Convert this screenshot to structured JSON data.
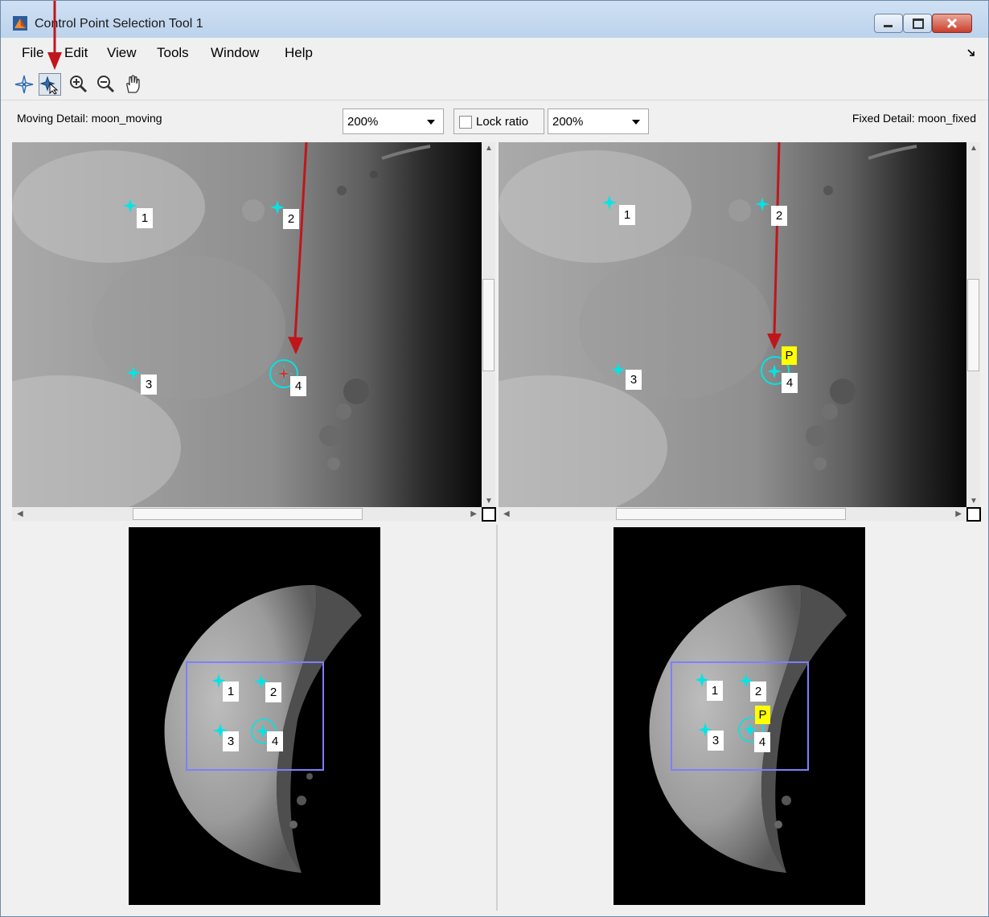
{
  "window": {
    "title": "Control Point Selection Tool 1",
    "buttons": [
      "minimize",
      "maximize",
      "close"
    ]
  },
  "menu": [
    "File",
    "Edit",
    "View",
    "Tools",
    "Window",
    "Help"
  ],
  "toolbar": {
    "icons": [
      "add-point-icon",
      "select-move-point-icon",
      "zoom-in-icon",
      "zoom-out-icon",
      "pan-hand-icon"
    ],
    "active": "select-move-point-icon"
  },
  "controls": {
    "moving_label": "Moving Detail: moon_moving",
    "fixed_label": "Fixed Detail: moon_fixed",
    "moving_zoom": "200%",
    "fixed_zoom": "200%",
    "lock_ratio_label": "Lock ratio",
    "lock_ratio_checked": false
  },
  "points": {
    "moving_detail": [
      "1",
      "2",
      "3",
      "4"
    ],
    "fixed_detail": [
      "1",
      "2",
      "3",
      "4"
    ],
    "predicted_marker": "P",
    "selected_point": "4"
  },
  "colors": {
    "point_marker": "#00e5e5",
    "predicted": "#ffff00",
    "annotation_arrow": "#c0161b",
    "detail_rect": "#7f7fff"
  }
}
